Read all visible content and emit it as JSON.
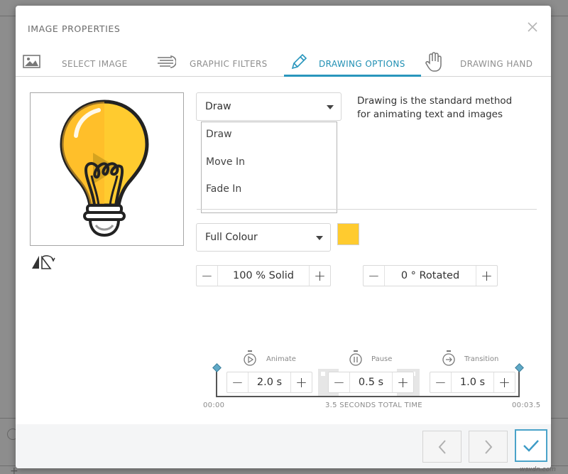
{
  "dialog": {
    "title": "IMAGE PROPERTIES"
  },
  "tabs": [
    {
      "label": "SELECT IMAGE",
      "icon": "image-icon",
      "active": false
    },
    {
      "label": "GRAPHIC FILTERS",
      "icon": "filter-lines-icon",
      "active": false
    },
    {
      "label": "DRAWING OPTIONS",
      "icon": "pencil-icon",
      "active": true
    },
    {
      "label": "DRAWING HAND",
      "icon": "hand-icon",
      "active": false
    }
  ],
  "preview": {
    "image": "light-bulb-icon"
  },
  "animation": {
    "selected": "Draw",
    "options": [
      "Draw",
      "Move In",
      "Fade In"
    ],
    "description": "Drawing is the standard method for animating text and images"
  },
  "colour": {
    "selected": "Full Colour",
    "swatch": "#ffcb2f"
  },
  "opacity": {
    "value": "100 % Solid"
  },
  "rotation": {
    "value": "0 ° Rotated"
  },
  "timing": {
    "animate": {
      "label": "Animate",
      "value": "2.0 s"
    },
    "pause": {
      "label": "Pause",
      "value": "0.5 s"
    },
    "transition": {
      "label": "Transition",
      "value": "1.0 s"
    },
    "start": "00:00",
    "end": "00:03.5",
    "total": "3.5 SECONDS TOTAL TIME"
  },
  "colors": {
    "accent": "#2996bd",
    "bulb": "#ffcb2f"
  },
  "watermark": "wsxdn.com"
}
